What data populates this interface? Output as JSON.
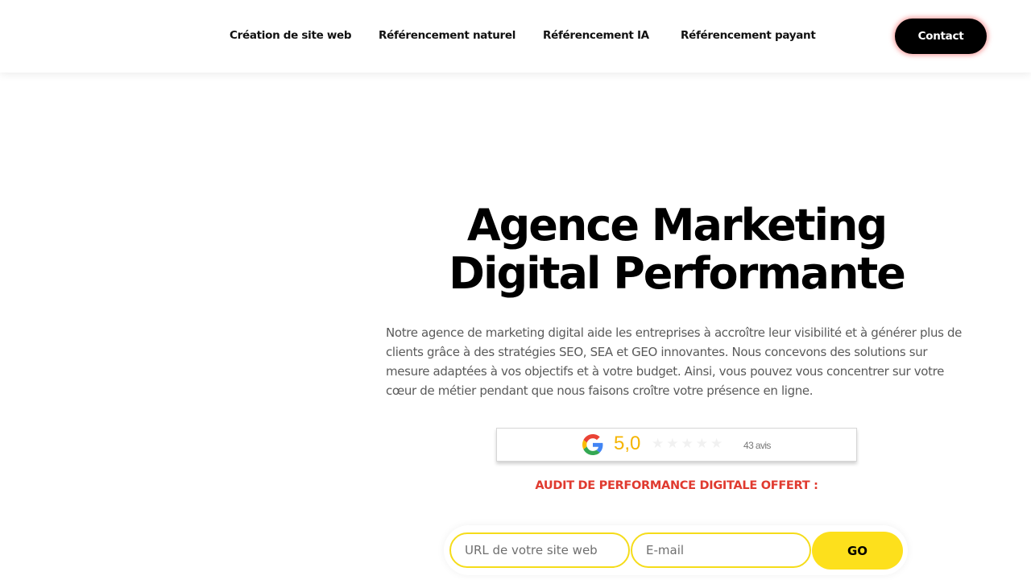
{
  "header": {
    "nav": [
      "Création de site web",
      "Référencement naturel",
      "Référencement IA",
      "Référencement payant"
    ],
    "contact_label": "Contact"
  },
  "hero": {
    "title_line1": "Agence Marketing",
    "title_line2": "Digital Performante",
    "description": "Notre agence de marketing digital aide les entreprises à accroître leur visibilité et à générer plus de clients grâce à des stratégies SEO, SEA et GEO innovantes. Nous concevons des solutions sur mesure adaptées à vos objectifs et à votre budget. Ainsi, vous pouvez vous concentrer sur votre cœur de métier pendant que nous faisons croître votre présence en ligne."
  },
  "rating": {
    "icon": "google-g-icon",
    "score": "5,0",
    "count": "43 avis",
    "stars_total": 5,
    "score_color": "#f5b400"
  },
  "audit": {
    "label": "AUDIT DE PERFORMANCE DIGITALE OFFERT :",
    "url_placeholder": "URL de votre site web",
    "url_value": "",
    "email_placeholder": "E-mail",
    "email_value": "",
    "go_label": "GO",
    "accent": "#fde01c",
    "label_color": "#e03a2f"
  }
}
